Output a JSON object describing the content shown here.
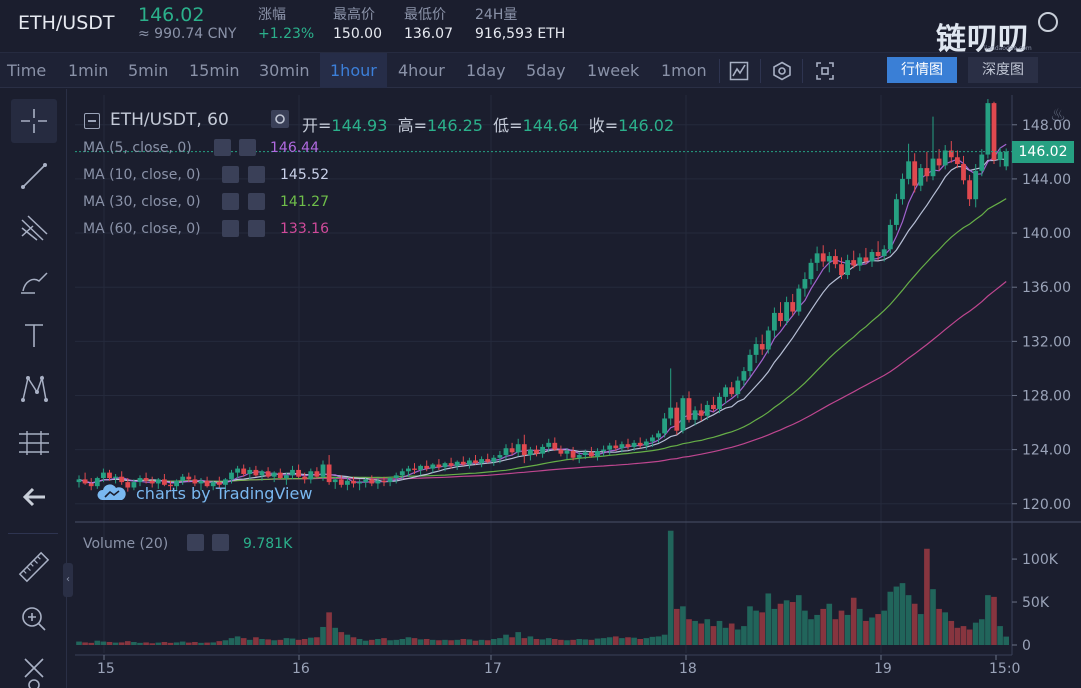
{
  "ticker": {
    "pair": "ETH/USDT",
    "last_price": "146.02",
    "cny_price": "≈ 990.74 CNY",
    "change_label": "涨幅",
    "change_value": "+1.23%",
    "high_label": "最高价",
    "high_value": "150.00",
    "low_label": "最低价",
    "low_value": "136.07",
    "volume_label": "24H量",
    "volume_value": "916,593 ETH"
  },
  "brand": {
    "logo_text": "链叨叨",
    "logo_sub": "liandaodao.com"
  },
  "toolbar": {
    "intervals": [
      "Time",
      "1min",
      "5min",
      "15min",
      "30min",
      "1hour",
      "4hour",
      "1day",
      "5day",
      "1week",
      "1mon"
    ],
    "active_interval": "1hour",
    "view_market": "行情图",
    "view_depth": "深度图"
  },
  "legend": {
    "title": "ETH/USDT, 60",
    "open_label": "开=",
    "open_value": "144.93",
    "high_label": "高=",
    "high_value": "146.25",
    "low_label": "低=",
    "low_value": "144.64",
    "close_label": "收=",
    "close_value": "146.02",
    "ma": [
      {
        "label": "MA (5, close, 0)",
        "value": "146.44",
        "color": "#b06ae0"
      },
      {
        "label": "MA (10, close, 0)",
        "value": "145.52",
        "color": "#c8d0e8"
      },
      {
        "label": "MA (30, close, 0)",
        "value": "141.27",
        "color": "#6fbf4a"
      },
      {
        "label": "MA (60, close, 0)",
        "value": "133.16",
        "color": "#d04a9a"
      }
    ],
    "watermark": "charts by TradingView",
    "volume_label": "Volume (20)",
    "volume_value": "9.781K"
  },
  "colors": {
    "up": "#26a082",
    "down": "#e0494f",
    "background": "#1b1e2e",
    "accent": "#3a7fd6"
  },
  "chart_data": {
    "type": "candlestick",
    "interval": "1hour",
    "y_ticks": [
      "148.00",
      "144.00",
      "140.00",
      "136.00",
      "132.00",
      "128.00",
      "124.00",
      "120.00"
    ],
    "ylim": [
      118.8,
      150.2
    ],
    "volume_ticks": [
      "100K",
      "50K",
      "0"
    ],
    "volume_ylim": [
      0,
      135000
    ],
    "x_ticks": [
      "15",
      "16",
      "17",
      "18",
      "19",
      "15:0"
    ],
    "current_price_tag": "146.02",
    "candles": [
      [
        121.6,
        122.1,
        121.2,
        121.8
      ],
      [
        121.8,
        122.3,
        121.4,
        121.5
      ],
      [
        121.5,
        121.9,
        121.0,
        121.3
      ],
      [
        121.3,
        122.0,
        121.1,
        121.9
      ],
      [
        121.9,
        122.6,
        121.6,
        122.3
      ],
      [
        122.3,
        122.5,
        121.7,
        121.9
      ],
      [
        121.9,
        122.2,
        121.5,
        122.0
      ],
      [
        122.0,
        122.4,
        121.4,
        121.6
      ],
      [
        121.6,
        121.9,
        120.9,
        121.2
      ],
      [
        121.2,
        121.8,
        121.0,
        121.6
      ],
      [
        121.6,
        122.1,
        121.3,
        121.9
      ],
      [
        121.9,
        122.3,
        121.5,
        121.7
      ],
      [
        121.7,
        122.0,
        121.2,
        121.5
      ],
      [
        121.5,
        121.9,
        121.1,
        121.8
      ],
      [
        121.8,
        122.2,
        121.3,
        121.4
      ],
      [
        121.4,
        121.7,
        120.9,
        121.3
      ],
      [
        121.3,
        121.8,
        121.0,
        121.7
      ],
      [
        121.7,
        122.2,
        121.4,
        122.0
      ],
      [
        122.0,
        122.3,
        121.6,
        121.8
      ],
      [
        121.8,
        122.1,
        121.3,
        121.5
      ],
      [
        121.5,
        121.9,
        121.0,
        121.7
      ],
      [
        121.7,
        122.0,
        121.2,
        121.3
      ],
      [
        121.3,
        121.7,
        121.0,
        121.6
      ],
      [
        121.6,
        122.0,
        121.2,
        121.4
      ],
      [
        121.4,
        121.9,
        121.0,
        121.8
      ],
      [
        121.8,
        122.5,
        121.5,
        122.3
      ],
      [
        122.3,
        122.8,
        121.9,
        122.6
      ],
      [
        122.6,
        122.9,
        122.0,
        122.2
      ],
      [
        122.2,
        122.7,
        121.8,
        122.5
      ],
      [
        122.5,
        122.8,
        122.0,
        122.1
      ],
      [
        122.1,
        122.5,
        121.7,
        122.4
      ],
      [
        122.4,
        122.7,
        121.9,
        122.0
      ],
      [
        122.0,
        122.4,
        121.6,
        122.3
      ],
      [
        122.3,
        122.6,
        121.8,
        121.9
      ],
      [
        121.9,
        122.3,
        121.4,
        122.1
      ],
      [
        122.1,
        122.8,
        121.8,
        122.5
      ],
      [
        122.5,
        122.9,
        121.9,
        122.0
      ],
      [
        122.0,
        122.3,
        121.5,
        121.8
      ],
      [
        121.8,
        122.6,
        121.5,
        122.4
      ],
      [
        122.4,
        122.7,
        121.9,
        122.0
      ],
      [
        122.0,
        123.2,
        121.7,
        122.9
      ],
      [
        122.9,
        123.6,
        121.4,
        121.6
      ],
      [
        121.6,
        122.0,
        121.1,
        121.8
      ],
      [
        121.8,
        122.1,
        121.2,
        121.4
      ],
      [
        121.4,
        121.9,
        121.0,
        121.7
      ],
      [
        121.7,
        122.0,
        121.2,
        121.5
      ],
      [
        121.5,
        121.8,
        121.0,
        121.6
      ],
      [
        121.6,
        121.9,
        121.2,
        121.8
      ],
      [
        121.8,
        122.1,
        121.3,
        121.5
      ],
      [
        121.5,
        121.9,
        121.1,
        121.7
      ],
      [
        121.7,
        122.0,
        121.3,
        121.6
      ],
      [
        121.6,
        122.0,
        121.3,
        121.9
      ],
      [
        121.9,
        122.3,
        121.5,
        122.1
      ],
      [
        122.1,
        122.6,
        121.8,
        122.4
      ],
      [
        122.4,
        122.8,
        122.0,
        122.6
      ],
      [
        122.6,
        123.0,
        122.2,
        122.5
      ],
      [
        122.5,
        122.9,
        122.1,
        122.8
      ],
      [
        122.8,
        123.2,
        122.4,
        122.6
      ],
      [
        122.6,
        123.0,
        122.3,
        122.9
      ],
      [
        122.9,
        123.3,
        122.5,
        122.7
      ],
      [
        122.7,
        123.1,
        122.4,
        123.0
      ],
      [
        123.0,
        123.4,
        122.6,
        122.8
      ],
      [
        122.8,
        123.2,
        122.5,
        123.1
      ],
      [
        123.1,
        123.5,
        122.8,
        122.9
      ],
      [
        122.9,
        123.4,
        122.6,
        123.2
      ],
      [
        123.2,
        123.6,
        122.9,
        123.0
      ],
      [
        123.0,
        123.5,
        122.7,
        123.3
      ],
      [
        123.3,
        123.7,
        123.0,
        123.1
      ],
      [
        123.1,
        123.6,
        122.8,
        123.4
      ],
      [
        123.4,
        123.9,
        123.0,
        123.6
      ],
      [
        123.6,
        124.4,
        123.3,
        124.1
      ],
      [
        124.1,
        124.5,
        123.6,
        123.8
      ],
      [
        123.8,
        124.8,
        123.5,
        124.4
      ],
      [
        124.4,
        125.1,
        123.0,
        123.6
      ],
      [
        123.6,
        124.2,
        123.2,
        124.0
      ],
      [
        124.0,
        124.3,
        123.5,
        123.7
      ],
      [
        123.7,
        124.4,
        123.4,
        124.2
      ],
      [
        124.2,
        124.8,
        123.8,
        124.5
      ],
      [
        124.5,
        124.9,
        123.9,
        124.0
      ],
      [
        124.0,
        124.3,
        123.5,
        123.7
      ],
      [
        123.7,
        124.1,
        123.3,
        123.9
      ],
      [
        123.9,
        124.2,
        123.2,
        123.4
      ],
      [
        123.4,
        123.8,
        123.0,
        123.6
      ],
      [
        123.6,
        124.0,
        123.3,
        123.8
      ],
      [
        123.8,
        124.2,
        123.4,
        123.5
      ],
      [
        123.5,
        124.1,
        123.2,
        123.9
      ],
      [
        123.9,
        124.3,
        123.5,
        124.0
      ],
      [
        124.0,
        124.5,
        123.6,
        124.3
      ],
      [
        124.3,
        124.7,
        123.9,
        124.1
      ],
      [
        124.1,
        124.6,
        123.8,
        124.4
      ],
      [
        124.4,
        124.8,
        124.0,
        124.2
      ],
      [
        124.2,
        124.7,
        123.9,
        124.5
      ],
      [
        124.5,
        124.9,
        124.1,
        124.3
      ],
      [
        124.3,
        124.8,
        124.0,
        124.6
      ],
      [
        124.6,
        125.1,
        124.2,
        124.9
      ],
      [
        124.9,
        125.4,
        124.5,
        125.2
      ],
      [
        125.2,
        126.7,
        124.9,
        126.3
      ],
      [
        126.3,
        130.0,
        125.8,
        127.1
      ],
      [
        127.1,
        127.5,
        125.1,
        125.4
      ],
      [
        125.4,
        128.0,
        125.2,
        127.8
      ],
      [
        127.8,
        128.3,
        126.0,
        126.2
      ],
      [
        126.2,
        127.2,
        125.8,
        126.9
      ],
      [
        126.9,
        127.4,
        126.1,
        126.5
      ],
      [
        126.5,
        127.6,
        126.2,
        127.3
      ],
      [
        127.3,
        127.9,
        126.8,
        127.0
      ],
      [
        127.0,
        128.2,
        126.7,
        127.9
      ],
      [
        127.9,
        128.8,
        127.4,
        128.6
      ],
      [
        128.6,
        129.0,
        127.9,
        128.1
      ],
      [
        128.1,
        129.4,
        127.8,
        129.1
      ],
      [
        129.1,
        130.1,
        128.7,
        129.8
      ],
      [
        129.8,
        131.4,
        129.4,
        131.0
      ],
      [
        131.0,
        132.3,
        130.4,
        131.8
      ],
      [
        131.8,
        132.5,
        131.0,
        131.4
      ],
      [
        131.4,
        133.1,
        131.1,
        132.8
      ],
      [
        132.8,
        134.5,
        132.3,
        134.1
      ],
      [
        134.1,
        134.9,
        133.1,
        133.5
      ],
      [
        133.5,
        135.3,
        133.2,
        134.9
      ],
      [
        134.9,
        135.5,
        133.9,
        134.2
      ],
      [
        134.2,
        136.2,
        133.9,
        135.9
      ],
      [
        135.9,
        137.1,
        135.3,
        136.6
      ],
      [
        136.6,
        138.1,
        136.2,
        137.8
      ],
      [
        137.8,
        139.0,
        137.2,
        138.5
      ],
      [
        138.5,
        139.1,
        137.5,
        137.9
      ],
      [
        137.9,
        138.6,
        137.1,
        138.3
      ],
      [
        138.3,
        138.8,
        137.4,
        137.7
      ],
      [
        137.7,
        138.2,
        136.6,
        136.9
      ],
      [
        136.9,
        138.4,
        136.6,
        138.0
      ],
      [
        138.0,
        138.7,
        137.4,
        137.6
      ],
      [
        137.6,
        138.5,
        137.2,
        138.2
      ],
      [
        138.2,
        138.9,
        137.7,
        137.9
      ],
      [
        137.9,
        138.8,
        137.5,
        138.6
      ],
      [
        138.6,
        139.4,
        138.0,
        138.3
      ],
      [
        138.3,
        139.1,
        137.9,
        138.8
      ],
      [
        138.8,
        141.0,
        138.5,
        140.6
      ],
      [
        140.6,
        142.9,
        140.2,
        142.5
      ],
      [
        142.5,
        144.4,
        142.1,
        144.0
      ],
      [
        144.0,
        146.6,
        143.6,
        145.3
      ],
      [
        145.3,
        145.9,
        143.0,
        143.5
      ],
      [
        143.5,
        145.1,
        143.1,
        144.8
      ],
      [
        144.8,
        146.0,
        143.8,
        144.2
      ],
      [
        144.2,
        148.6,
        143.9,
        145.5
      ],
      [
        145.5,
        146.2,
        144.6,
        145.0
      ],
      [
        145.0,
        146.5,
        144.7,
        146.1
      ],
      [
        146.1,
        146.8,
        145.2,
        145.6
      ],
      [
        145.6,
        146.1,
        144.8,
        145.1
      ],
      [
        145.1,
        145.7,
        143.6,
        143.9
      ],
      [
        143.9,
        144.3,
        142.0,
        142.5
      ],
      [
        142.5,
        145.1,
        141.9,
        144.6
      ],
      [
        144.6,
        146.2,
        144.2,
        145.8
      ],
      [
        145.8,
        149.9,
        145.5,
        149.6
      ],
      [
        149.6,
        149.7,
        145.1,
        145.4
      ],
      [
        145.4,
        146.3,
        144.9,
        146.0
      ],
      [
        144.93,
        146.25,
        144.64,
        146.02
      ]
    ],
    "volumes": [
      4000,
      3000,
      2500,
      5000,
      4000,
      3500,
      2800,
      3000,
      4500,
      3500,
      2500,
      3000,
      2000,
      2800,
      3500,
      2500,
      3000,
      4000,
      2800,
      3500,
      2500,
      2800,
      3000,
      4500,
      5500,
      8000,
      10000,
      8000,
      6000,
      9000,
      7000,
      6500,
      5500,
      6000,
      8000,
      7500,
      6000,
      7000,
      8500,
      9000,
      21000,
      38000,
      20000,
      15000,
      12000,
      9000,
      7000,
      5000,
      6000,
      7000,
      8000,
      5500,
      6000,
      7000,
      9000,
      8000,
      6500,
      7000,
      6000,
      5500,
      6000,
      5500,
      6000,
      7000,
      6500,
      5000,
      6000,
      5500,
      7000,
      8000,
      12000,
      9000,
      15000,
      8000,
      10000,
      7000,
      6500,
      8000,
      7000,
      6000,
      5500,
      6000,
      7000,
      6500,
      6000,
      7500,
      8000,
      9000,
      10000,
      8000,
      9000,
      8500,
      7000,
      8000,
      9500,
      10000,
      12000,
      133000,
      42000,
      45000,
      30000,
      28000,
      25000,
      30000,
      22000,
      28000,
      20000,
      25000,
      18000,
      22000,
      45000,
      40000,
      38000,
      60000,
      42000,
      48000,
      52000,
      50000,
      58000,
      40000,
      30000,
      35000,
      42000,
      48000,
      30000,
      40000,
      35000,
      55000,
      42000,
      28000,
      32000,
      36000,
      40000,
      62000,
      68000,
      72000,
      58000,
      48000,
      36000,
      112000,
      65000,
      42000,
      38000,
      28000,
      20000,
      22000,
      18000,
      26000,
      30000,
      58000,
      56000,
      22000,
      9781
    ]
  }
}
